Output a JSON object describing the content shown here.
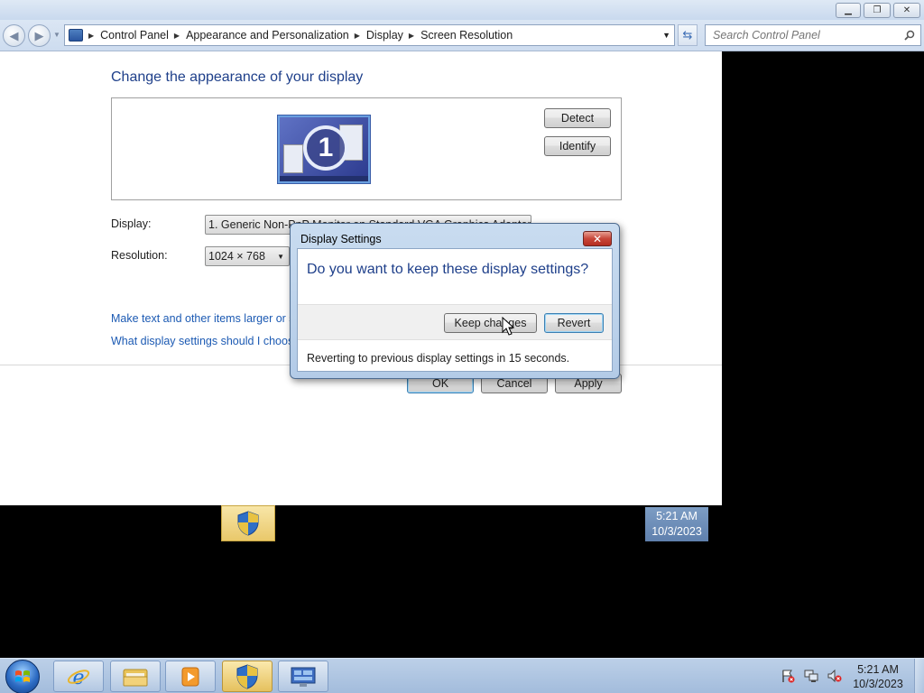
{
  "window": {
    "breadcrumb": [
      "Control Panel",
      "Appearance and Personalization",
      "Display",
      "Screen Resolution"
    ],
    "search_placeholder": "Search Control Panel"
  },
  "content": {
    "heading": "Change the appearance of your display",
    "monitor_number": "1",
    "detect_label": "Detect",
    "identify_label": "Identify",
    "display_label": "Display:",
    "display_value": "1. Generic Non-PnP Monitor on Standard VGA Graphics Adapter",
    "resolution_label": "Resolution:",
    "resolution_value": "1024 × 768",
    "advanced_fragment": "s",
    "link_text_size": "Make text and other items larger or sm",
    "link_display_settings": "What display settings should I choose",
    "ok_label": "OK",
    "cancel_label": "Cancel",
    "apply_label": "Apply"
  },
  "dialog": {
    "title": "Display Settings",
    "question": "Do you want to keep these display settings?",
    "keep_label": "Keep changes",
    "revert_label": "Revert",
    "footer": "Reverting to previous display settings in 15 seconds."
  },
  "ghost_clock": {
    "time": "5:21 AM",
    "date": "10/3/2023"
  },
  "taskbar": {
    "time": "5:21 AM",
    "date": "10/3/2023",
    "buttons": [
      "internet-explorer",
      "windows-explorer",
      "media-player",
      "security-shield",
      "display-settings"
    ]
  },
  "colors": {
    "accent_blue": "#1e3f8a",
    "link_blue": "#1c5ab3",
    "close_red": "#c8473a"
  }
}
